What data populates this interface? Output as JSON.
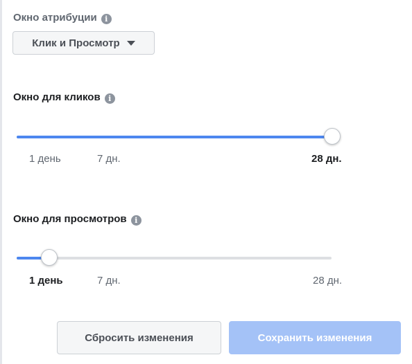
{
  "attribution": {
    "label": "Окно атрибуции",
    "info_icon": "i",
    "dropdown_value": "Клик и Просмотр"
  },
  "clicks": {
    "label": "Окно для кликов",
    "info_icon": "i",
    "ticks": [
      "1 день",
      "7 дн.",
      "28 дн."
    ],
    "selected": "28 дн.",
    "value_fraction": 1.0
  },
  "views": {
    "label": "Окно для просмотров",
    "info_icon": "i",
    "ticks": [
      "1 день",
      "7 дн.",
      "28 дн."
    ],
    "selected": "1 день",
    "value_fraction": 0.0
  },
  "buttons": {
    "reset_label": "Сбросить изменения",
    "save_label": "Сохранить изменения"
  },
  "colors": {
    "accent": "#4d87ef",
    "save_disabled": "#a4c2f7"
  }
}
